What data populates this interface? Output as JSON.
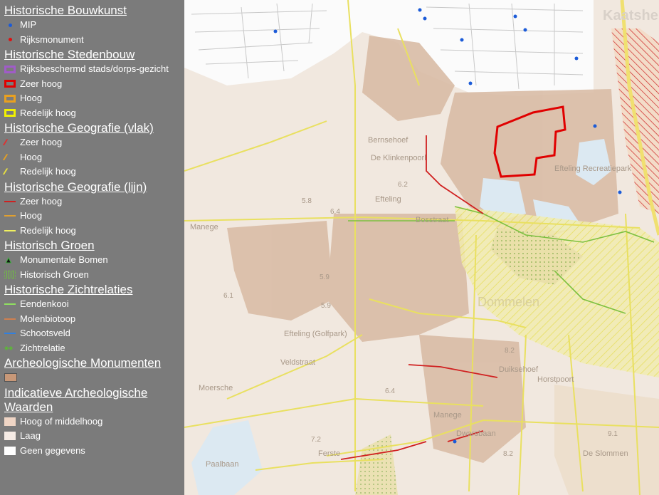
{
  "legend": {
    "sections": [
      {
        "title": "Historische Bouwkunst",
        "items": [
          {
            "label": "MIP",
            "sym": "dot",
            "color": "#1b5bd8"
          },
          {
            "label": "Rijksmonument",
            "sym": "dot",
            "color": "#e01010"
          }
        ]
      },
      {
        "title": "Historische Stedenbouw",
        "items": [
          {
            "label": "Rijksbeschermd stads/dorps-gezicht",
            "sym": "box",
            "color": "#a05cc8"
          },
          {
            "label": "Zeer hoog",
            "sym": "box",
            "color": "#e00000"
          },
          {
            "label": "Hoog",
            "sym": "box",
            "color": "#e8a020"
          },
          {
            "label": "Redelijk hoog",
            "sym": "box",
            "color": "#f0f000"
          }
        ]
      },
      {
        "title": "Historische Geografie (vlak)",
        "items": [
          {
            "label": "Zeer hoog",
            "sym": "slash",
            "color": "#e03030"
          },
          {
            "label": "Hoog",
            "sym": "slash",
            "color": "#e8a020"
          },
          {
            "label": "Redelijk hoog",
            "sym": "slash",
            "color": "#e8e040"
          }
        ]
      },
      {
        "title": "Historische Geografie (lijn)",
        "items": [
          {
            "label": "Zeer hoog",
            "sym": "line",
            "color": "#d02020"
          },
          {
            "label": "Hoog",
            "sym": "line",
            "color": "#e0a030"
          },
          {
            "label": "Redelijk hoog",
            "sym": "line",
            "color": "#f0f060"
          }
        ]
      },
      {
        "title": "Historisch Groen",
        "items": [
          {
            "label": "Monumentale Bomen",
            "sym": "tri",
            "color": "#40b040"
          },
          {
            "label": "Historisch Groen",
            "sym": "dotbox",
            "color": "#70c040"
          }
        ]
      },
      {
        "title": "Historische Zichtrelaties",
        "items": [
          {
            "label": "Eendenkooi",
            "sym": "line",
            "color": "#90e060"
          },
          {
            "label": "Molenbiotoop",
            "sym": "line",
            "color": "#d08050"
          },
          {
            "label": "Schootsveld",
            "sym": "line",
            "color": "#3080e0"
          },
          {
            "label": "Zichtrelatie",
            "sym": "arrow",
            "color": "#60b040"
          }
        ]
      },
      {
        "title": "Archeologische Monumenten",
        "items": [
          {
            "label": "",
            "sym": "box",
            "color": "#c89878"
          }
        ]
      },
      {
        "title": "Indicatieve Archeologische Waarden",
        "items": [
          {
            "label": "Hoog of middelhoog",
            "sym": "fill",
            "color": "#efd5c5"
          },
          {
            "label": "Laag",
            "sym": "fill",
            "color": "#f5ebe5"
          },
          {
            "label": "Geen gegevens",
            "sym": "fill",
            "color": "#ffffff"
          }
        ]
      }
    ]
  },
  "map": {
    "place_labels": [
      "De Klinkenpoorl",
      "Efteling",
      "Manege",
      "Efteling (Golfpark)",
      "Moersche",
      "Veldstraat",
      "Duiksehoef",
      "Manege",
      "Dwarsbaan",
      "De Slommen",
      "Kaatsheuvel",
      "Dommelen",
      "Bosstraat",
      "Bernsehoef",
      "Efteling Recreatiepark",
      "Horstpoort",
      "Paalbaan",
      "Ferste"
    ],
    "elevations": [
      "6.2",
      "5.8",
      "6.4",
      "5.9",
      "6.1",
      "5.9",
      "6.4",
      "7.2",
      "8.2",
      "9.1",
      "8.2"
    ]
  }
}
